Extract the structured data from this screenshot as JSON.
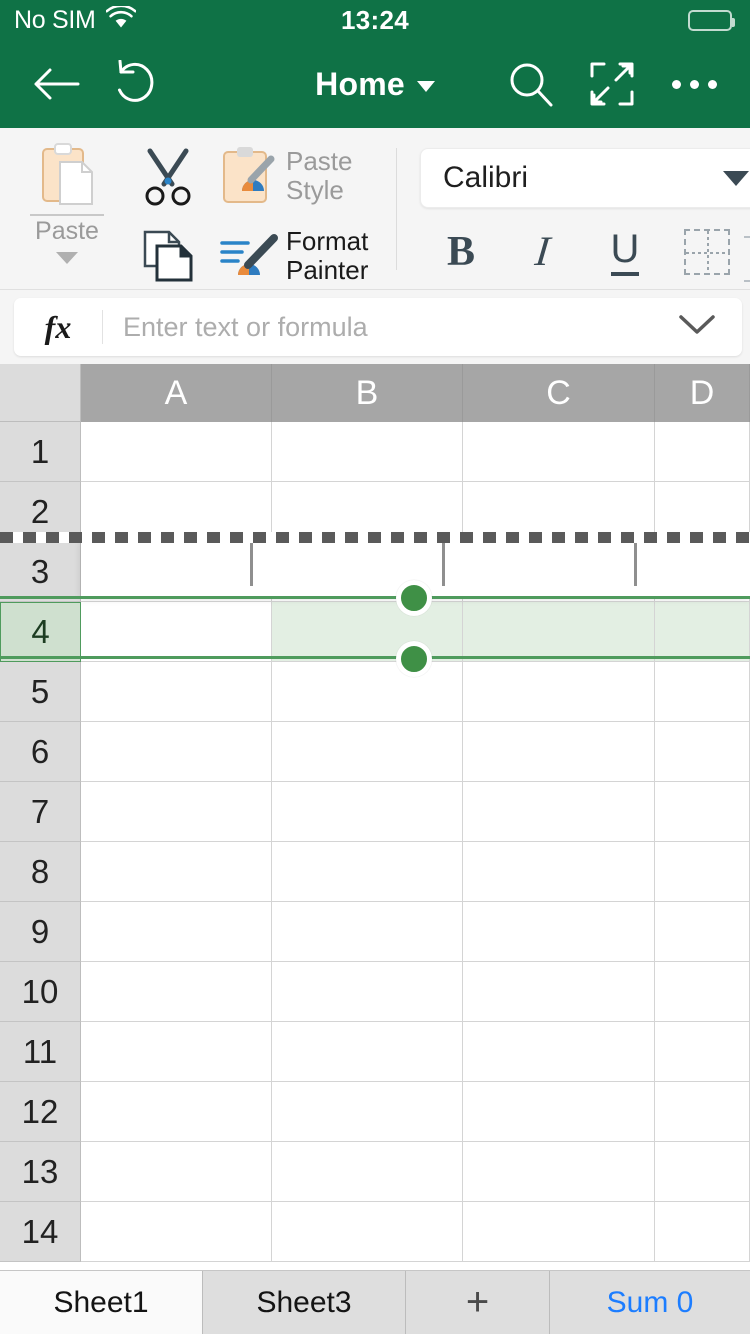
{
  "statusbar": {
    "carrier": "No SIM",
    "time": "13:24",
    "wifi_icon": "wifi-icon",
    "battery_icon": "battery-low-icon"
  },
  "appbar": {
    "back_icon": "back-arrow-icon",
    "undo_icon": "undo-icon",
    "title": "Home",
    "title_caret_icon": "chevron-down-icon",
    "search_icon": "search-icon",
    "expand_icon": "fullscreen-expand-icon",
    "more_icon": "more-options-icon",
    "accent_color": "#0f7246"
  },
  "ribbon": {
    "paste": {
      "label": "Paste",
      "icon": "paste-clipboard-icon",
      "caret_icon": "caret-down-icon",
      "disabled": true
    },
    "cut": {
      "icon": "scissors-icon",
      "label": ""
    },
    "copy": {
      "icon": "copy-pages-icon",
      "label": ""
    },
    "paste_style": {
      "label": "Paste\nStyle",
      "label_line1": "Paste",
      "label_line2": "Style",
      "icon": "paste-style-icon",
      "disabled": true
    },
    "format_painter": {
      "label_line1": "Format",
      "label_line2": "Painter",
      "icon": "format-painter-icon",
      "disabled": false
    },
    "font": {
      "name": "Calibri",
      "caret_icon": "chevron-down-icon"
    },
    "bold": {
      "label": "B",
      "icon": "bold-icon"
    },
    "italic": {
      "label": "I",
      "icon": "italic-icon"
    },
    "underline": {
      "label": "U",
      "icon": "underline-icon"
    },
    "borders": {
      "icon": "borders-grid-icon"
    }
  },
  "formula_bar": {
    "fx_label": "fx",
    "placeholder": "Enter text or formula",
    "value": "",
    "expand_icon": "chevron-down-icon"
  },
  "grid": {
    "columns": [
      "A",
      "B",
      "C",
      "D"
    ],
    "rows": [
      "1",
      "2",
      "3",
      "4",
      "5",
      "6",
      "7",
      "8",
      "9",
      "10",
      "11",
      "12",
      "13",
      "14"
    ],
    "selected_row": "4",
    "selection_color": "#4f9b5d",
    "selection_fill": "#e3efe3",
    "cut_marquee_after_row": "2",
    "drag_row": "3",
    "handle_icon": "selection-handle-icon",
    "cells": []
  },
  "tabbar": {
    "sheets": [
      {
        "name": "Sheet1",
        "active": true
      },
      {
        "name": "Sheet3",
        "active": false
      }
    ],
    "add_label": "+",
    "add_icon": "add-sheet-icon",
    "sum_label": "Sum 0",
    "sum_color": "#1c7dff"
  }
}
